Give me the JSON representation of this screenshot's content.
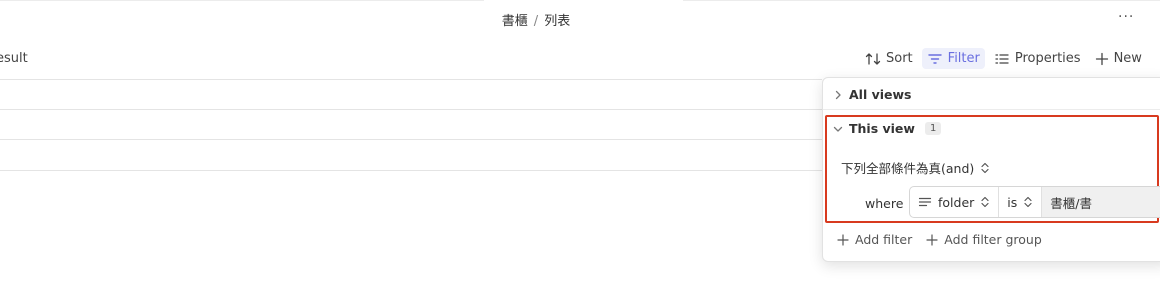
{
  "breadcrumb": {
    "parent": "書櫃",
    "separator": "/",
    "current": "列表"
  },
  "header": {
    "more_label": "···"
  },
  "left": {
    "result_label": "esult"
  },
  "toolbar": {
    "sort_label": "Sort",
    "filter_label": "Filter",
    "properties_label": "Properties",
    "new_label": "New",
    "accent_color": "#6a6fe0"
  },
  "filter_panel": {
    "all_views_label": "All views",
    "this_view_label": "This view",
    "this_view_count": "1",
    "condition_label": "下列全部條件為真(and)",
    "where_label": "where",
    "field_label": "folder",
    "operator_label": "is",
    "value_label": "書櫃/書",
    "add_filter_label": "Add filter",
    "add_filter_group_label": "Add filter group",
    "highlight_color": "#d83a1f"
  }
}
